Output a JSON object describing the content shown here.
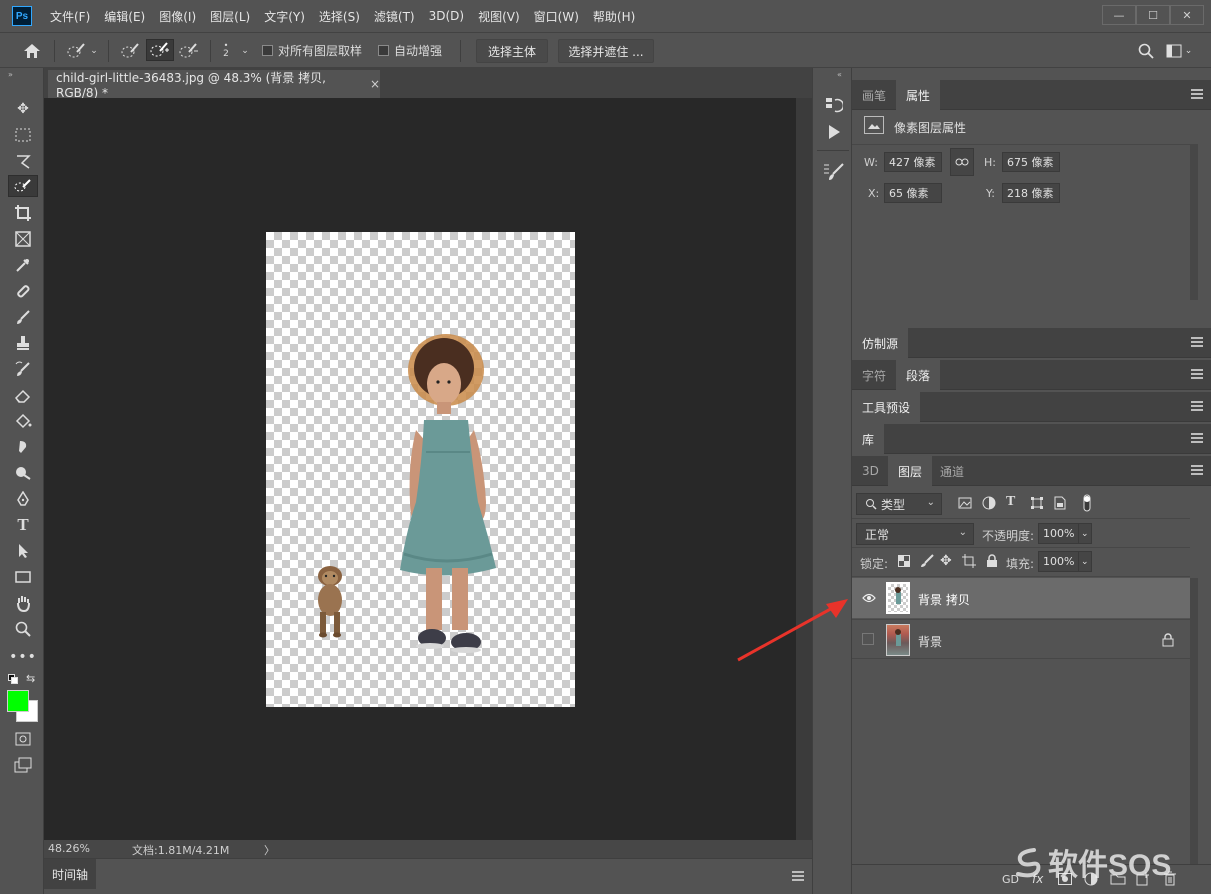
{
  "app": {
    "logo": "Ps"
  },
  "menu": [
    "文件(F)",
    "编辑(E)",
    "图像(I)",
    "图层(L)",
    "文字(Y)",
    "选择(S)",
    "滤镜(T)",
    "3D(D)",
    "视图(V)",
    "窗口(W)",
    "帮助(H)"
  ],
  "options": {
    "brush_size": "2",
    "sample_all_layers": "对所有图层取样",
    "auto_enhance": "自动增强",
    "select_subject": "选择主体",
    "select_and_mask": "选择并遮住 ..."
  },
  "document": {
    "tab_title": "child-girl-little-36483.jpg @ 48.3% (背景 拷贝, RGB/8) *",
    "close": "×"
  },
  "status": {
    "zoom": "48.26%",
    "doc": "文档:1.81M/4.21M",
    "arrow": "〉"
  },
  "timeline": {
    "label": "时间轴"
  },
  "properties_panel": {
    "tabs": [
      "画笔",
      "属性"
    ],
    "active_tab": "属性",
    "heading": "像素图层属性",
    "w_label": "W:",
    "w_value": "427 像素",
    "h_label": "H:",
    "h_value": "675 像素",
    "x_label": "X:",
    "x_value": "65 像素",
    "y_label": "Y:",
    "y_value": "218 像素"
  },
  "collapsed_panels": {
    "clone_source": "仿制源",
    "character": "字符",
    "paragraph": "段落",
    "tool_presets": "工具预设",
    "library": "库"
  },
  "layers_panel": {
    "tabs": [
      "3D",
      "图层",
      "通道"
    ],
    "active_tab": "图层",
    "filter": "类型",
    "blend_mode": "正常",
    "opacity_label": "不透明度:",
    "opacity": "100%",
    "lock_label": "锁定:",
    "fill_label": "填充:",
    "fill": "100%",
    "layers": [
      {
        "name": "背景 拷贝",
        "visible": true,
        "selected": true,
        "locked": false
      },
      {
        "name": "背景",
        "visible": false,
        "selected": false,
        "locked": true
      }
    ]
  },
  "watermark": "软件SOS",
  "colors": {
    "foreground": "#00ff00",
    "background": "#ffffff",
    "annotation_arrow": "#e8332a"
  }
}
